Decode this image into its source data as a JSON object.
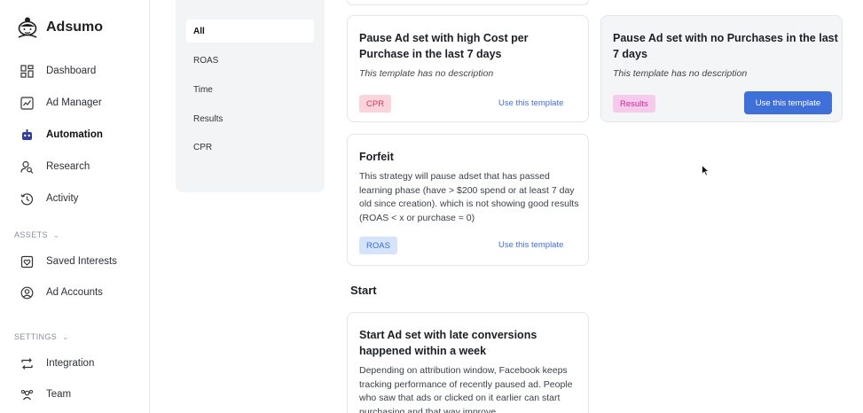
{
  "app": {
    "name": "Adsumo"
  },
  "sidebar": {
    "items": [
      {
        "label": "Dashboard",
        "icon": "dashboard-icon"
      },
      {
        "label": "Ad Manager",
        "icon": "ad-manager-icon"
      },
      {
        "label": "Automation",
        "icon": "automation-icon",
        "active": true
      },
      {
        "label": "Research",
        "icon": "research-icon"
      },
      {
        "label": "Activity",
        "icon": "activity-icon"
      }
    ],
    "assets_label": "ASSETS",
    "assets_items": [
      {
        "label": "Saved Interests",
        "icon": "saved-interests-icon"
      },
      {
        "label": "Ad Accounts",
        "icon": "ad-accounts-icon"
      }
    ],
    "settings_label": "SETTINGS",
    "settings_items": [
      {
        "label": "Integration",
        "icon": "integration-icon"
      },
      {
        "label": "Team",
        "icon": "team-icon"
      }
    ]
  },
  "filters": [
    "All",
    "ROAS",
    "Time",
    "Results",
    "CPR"
  ],
  "cards": {
    "cpr_card": {
      "title": "Pause Ad set with high Cost per Purchase in the last 7 days",
      "description": "This template has no description",
      "tag": "CPR",
      "action": "Use this template"
    },
    "no_purchase_card": {
      "title": "Pause Ad set with no Purchases in the last 7 days",
      "description": "This template has no description",
      "tag": "Results",
      "action": "Use this template"
    },
    "forfeit_card": {
      "title": "Forfeit",
      "description": "This strategy will pause adset that has passed learning phase (have > $200 spend or at least 7 day old since creation). which is not showing good results (ROAS < x or purchase = 0)",
      "tag": "ROAS",
      "action": "Use this template"
    },
    "start_card": {
      "title": "Start Ad set with late conversions happened within a week",
      "description": "Depending on attribution window, Facebook keeps tracking performance of recently paused ad. People who saw that ads or clicked on it earlier can start purchasing and that way improve"
    }
  },
  "sections": {
    "start": "Start"
  },
  "colors": {
    "accent": "#3f6fd8",
    "tag_cpr_bg": "#fbd3dd",
    "tag_cpr_text": "#d13a5c",
    "tag_results_bg": "#f7c9ea",
    "tag_results_text": "#c2309c",
    "tag_roas_bg": "#d6e4fb",
    "tag_roas_text": "#3b6ed6"
  }
}
